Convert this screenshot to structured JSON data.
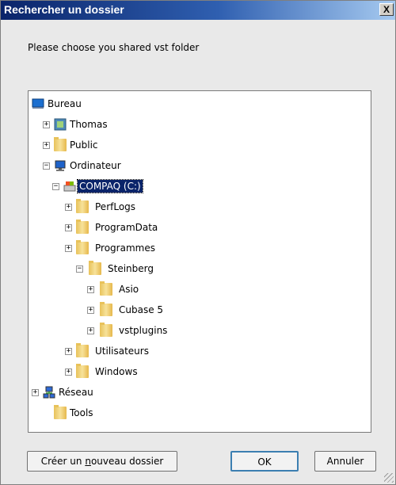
{
  "dialog": {
    "title": "Rechercher un dossier",
    "close_label": "X",
    "prompt": "Please choose you shared vst folder"
  },
  "tree": {
    "items": [
      {
        "label": "Bureau",
        "icon": "desktop-icon",
        "expander": ""
      },
      {
        "label": "Thomas",
        "icon": "user-folder-icon",
        "expander": "+"
      },
      {
        "label": "Public",
        "icon": "folder-icon",
        "expander": "+"
      },
      {
        "label": "Ordinateur",
        "icon": "computer-icon",
        "expander": "−"
      },
      {
        "label": "COMPAQ (C:)",
        "icon": "drive-icon",
        "expander": "−",
        "selected": true
      },
      {
        "label": "PerfLogs",
        "icon": "folder-icon",
        "expander": "+"
      },
      {
        "label": "ProgramData",
        "icon": "folder-icon",
        "expander": "+"
      },
      {
        "label": "Programmes",
        "icon": "folder-icon",
        "expander": "+"
      },
      {
        "label": "Steinberg",
        "icon": "folder-icon",
        "expander": "−"
      },
      {
        "label": "Asio",
        "icon": "folder-icon",
        "expander": "+"
      },
      {
        "label": "Cubase 5",
        "icon": "folder-icon",
        "expander": "+"
      },
      {
        "label": "vstplugins",
        "icon": "folder-icon",
        "expander": "+"
      },
      {
        "label": "Utilisateurs",
        "icon": "folder-icon",
        "expander": "+"
      },
      {
        "label": "Windows",
        "icon": "folder-icon",
        "expander": "+"
      },
      {
        "label": "Réseau",
        "icon": "network-icon",
        "expander": "+"
      },
      {
        "label": "Tools",
        "icon": "folder-icon",
        "expander": ""
      }
    ]
  },
  "buttons": {
    "new_folder_prefix": "Créer un ",
    "new_folder_accel": "n",
    "new_folder_suffix": "ouveau dossier",
    "ok": "OK",
    "cancel": "Annuler"
  },
  "colors": {
    "selection": "#0a246a",
    "title_start": "#0a246a",
    "title_end": "#a6caf0"
  }
}
